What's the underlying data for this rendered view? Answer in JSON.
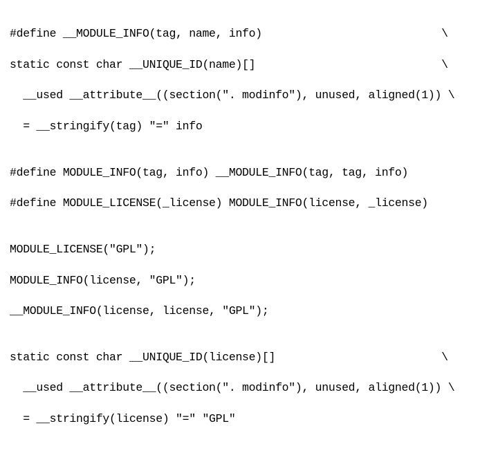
{
  "lines": [
    "#define __MODULE_INFO(tag, name, info)                           \\",
    "static const char __UNIQUE_ID(name)[]                            \\",
    "  __used __attribute__((section(\". modinfo\"), unused, aligned(1)) \\",
    "  = __stringify(tag) \"=\" info",
    "",
    "#define MODULE_INFO(tag, info) __MODULE_INFO(tag, tag, info)",
    "#define MODULE_LICENSE(_license) MODULE_INFO(license, _license)",
    "",
    "MODULE_LICENSE(\"GPL\");",
    "MODULE_INFO(license, \"GPL\");",
    "__MODULE_INFO(license, license, \"GPL\");",
    "",
    "static const char __UNIQUE_ID(license)[]                         \\",
    "  __used __attribute__((section(\". modinfo\"), unused, aligned(1)) \\",
    "  = __stringify(license) \"=\" \"GPL\""
  ]
}
